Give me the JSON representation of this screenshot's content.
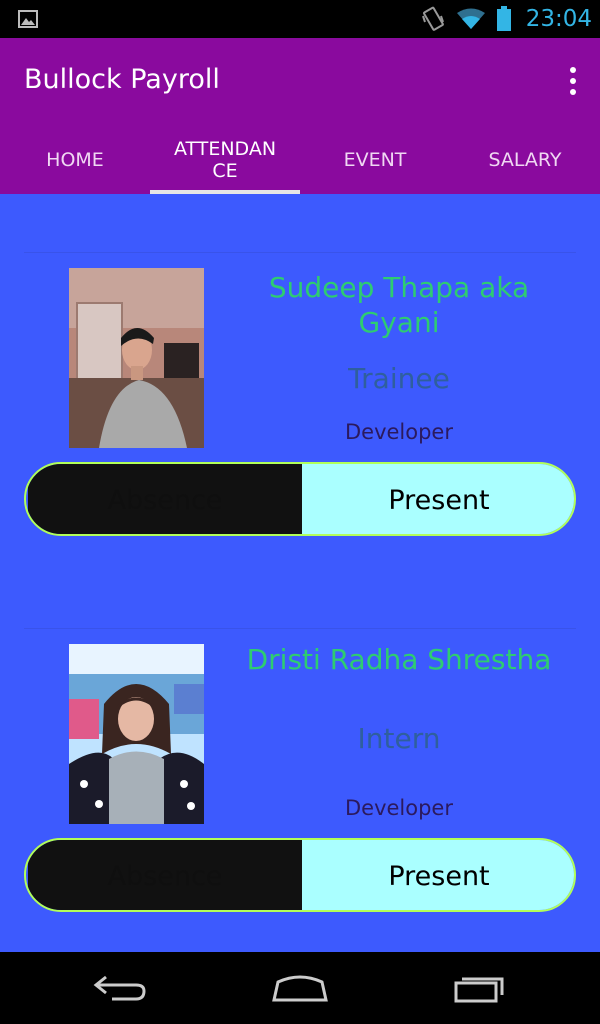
{
  "status_bar": {
    "time": "23:04"
  },
  "app_bar": {
    "title": "Bullock Payroll"
  },
  "tabs": [
    {
      "label": "HOME",
      "active": false
    },
    {
      "label": "ATTENDAN\nCE",
      "active": true
    },
    {
      "label": "EVENT",
      "active": false
    },
    {
      "label": "SALARY",
      "active": false
    }
  ],
  "employees": [
    {
      "name": "Sudeep Thapa aka Gyani",
      "role": "Trainee",
      "department": "Developer",
      "absence_label": "Absence",
      "present_label": "Present"
    },
    {
      "name": "Dristi Radha Shrestha",
      "role": "Intern",
      "department": "Developer",
      "absence_label": "Absence",
      "present_label": "Present"
    }
  ],
  "colors": {
    "app_bar": "#8a0a9e",
    "content_bg": "#3d5afe",
    "name": "#2ecc71",
    "present_bg": "#aaffff",
    "absence_bg": "#111111",
    "toggle_border": "#b2ff59"
  }
}
